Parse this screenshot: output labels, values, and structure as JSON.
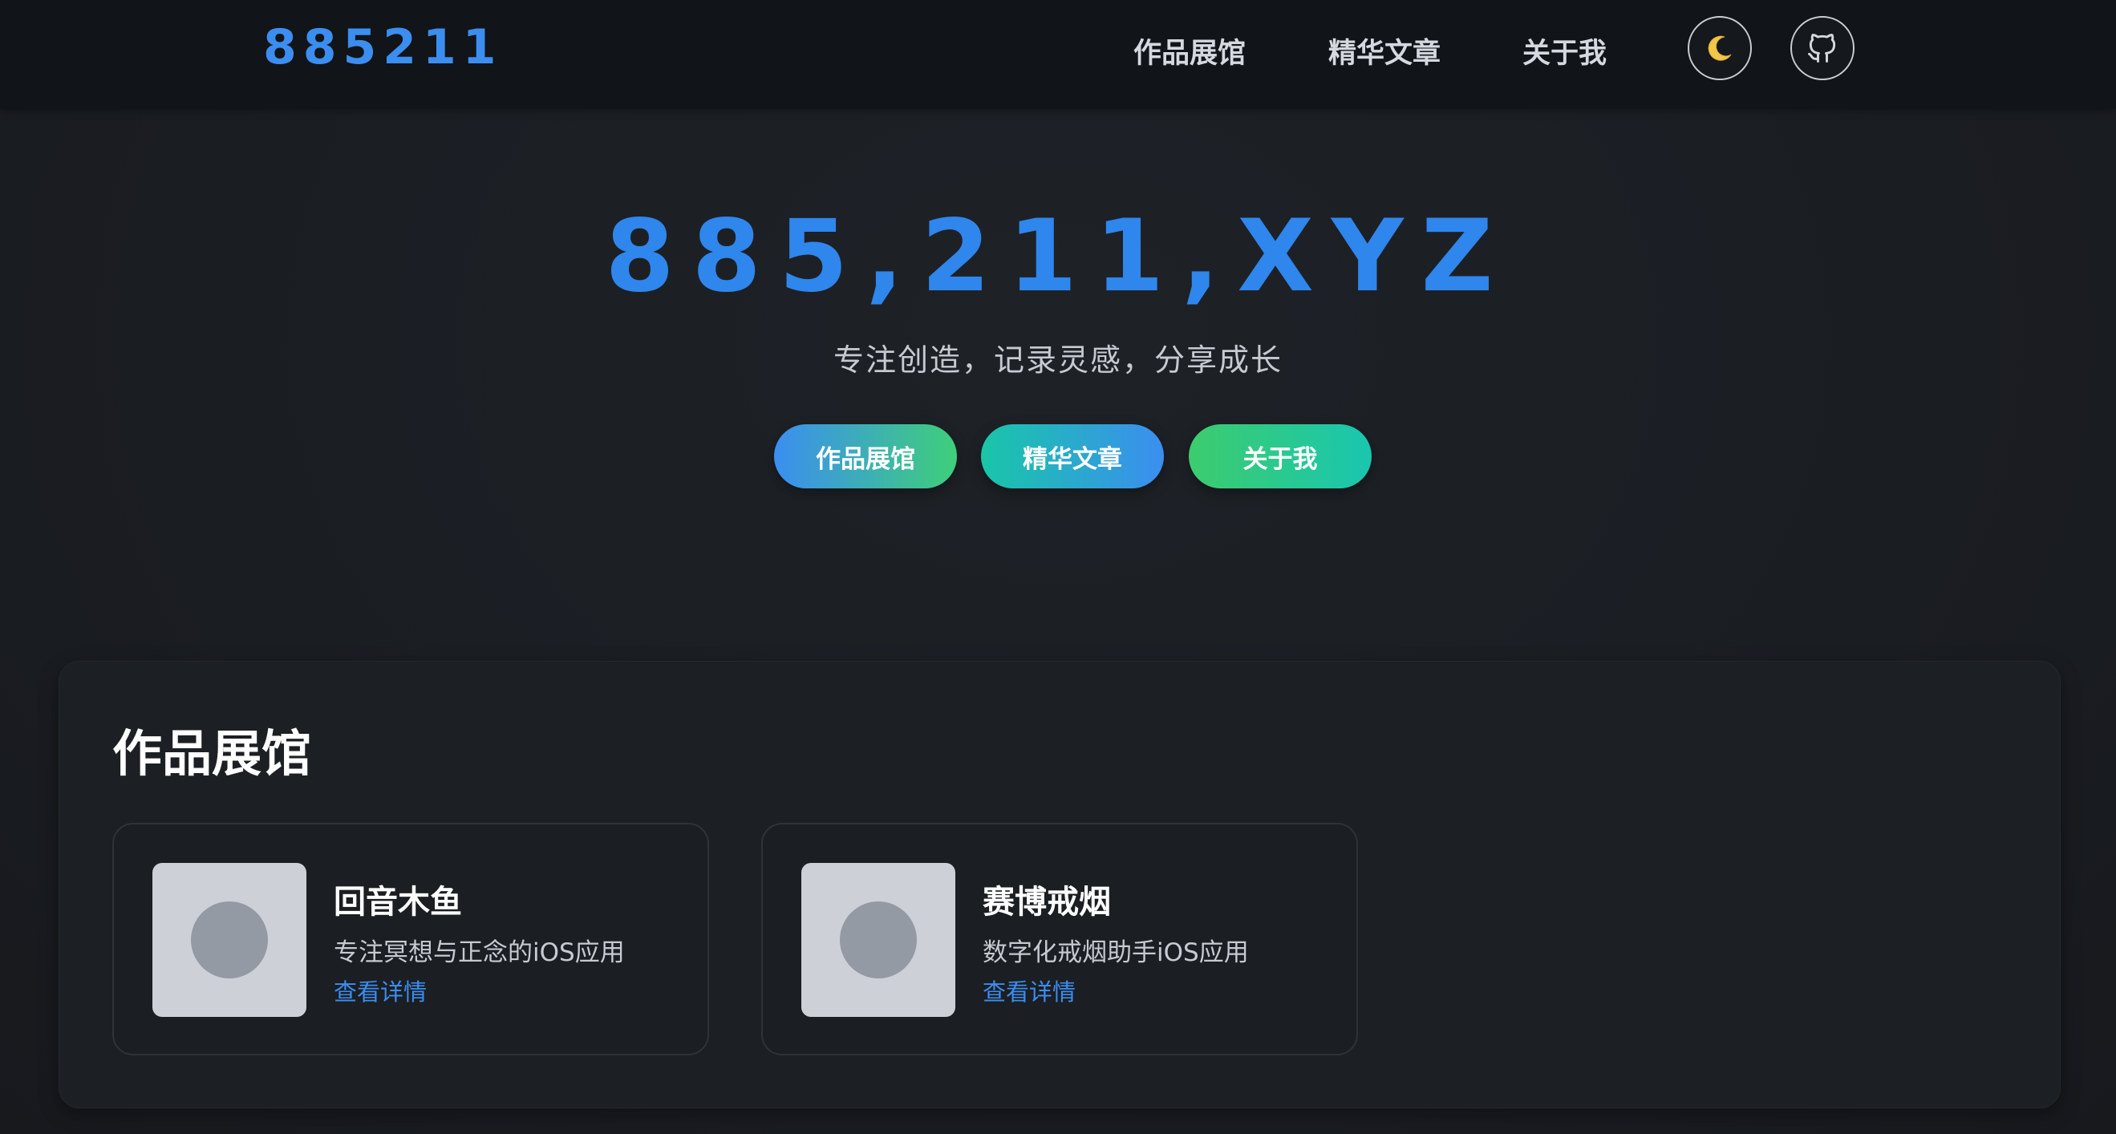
{
  "header": {
    "logo": "885211",
    "nav": [
      "作品展馆",
      "精华文章",
      "关于我"
    ],
    "theme_icon": "moon-icon",
    "github_icon": "github-icon"
  },
  "hero": {
    "title": "885,211,XYZ",
    "subtitle": "专注创造，记录灵感，分享成长",
    "buttons": [
      "作品展馆",
      "精华文章",
      "关于我"
    ]
  },
  "section": {
    "title": "作品展馆",
    "cards": [
      {
        "title": "回音木鱼",
        "description": "专注冥想与正念的iOS应用",
        "link": "查看详情"
      },
      {
        "title": "赛博戒烟",
        "description": "数字化戒烟助手iOS应用",
        "link": "查看详情"
      }
    ]
  },
  "colors": {
    "accent": "#3b8ef0",
    "background": "#1b1e23",
    "header": "#111418",
    "green": "#3dcc6e",
    "teal": "#19c6a8"
  }
}
